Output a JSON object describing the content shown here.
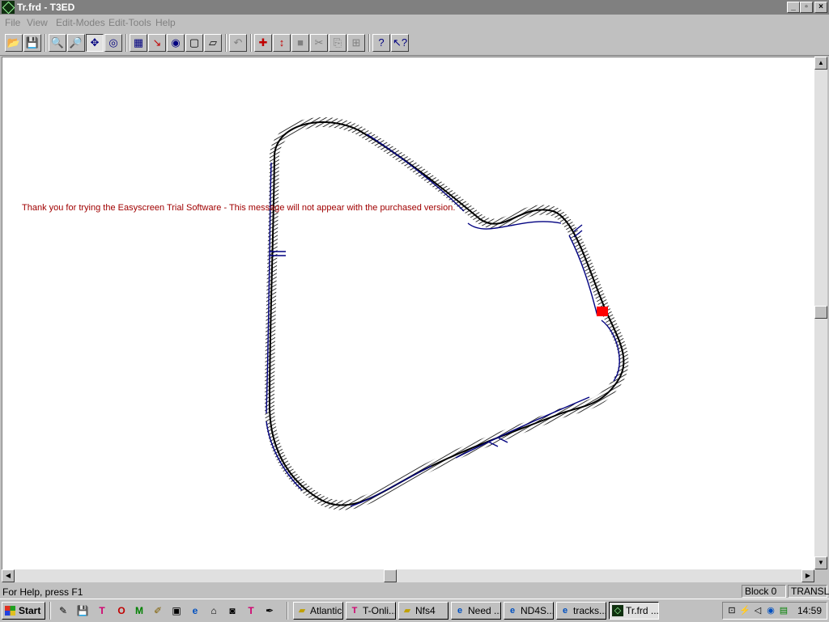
{
  "window": {
    "title": "Tr.frd - T3ED",
    "minimize": "_",
    "maximize": "▫",
    "close": "×"
  },
  "menu": [
    "File",
    "View",
    "Edit-Modes",
    "Edit-Tools",
    "Help"
  ],
  "toolbar_icons": [
    "open-icon",
    "save-icon",
    "zoom-in-icon",
    "zoom-out-icon",
    "move-icon",
    "rotate-view-icon",
    "track-mode-icon",
    "node-mode-icon",
    "object-mode-icon",
    "block-mode-icon",
    "polygon-mode-icon",
    "undo-icon",
    "translate-icon",
    "vertical-move-icon",
    "fill-icon",
    "cut-icon",
    "copy-icon",
    "paste-icon",
    "help-icon",
    "context-help-icon"
  ],
  "canvas": {
    "trial_message": "Thank you for trying the Easyscreen Trial Software - This message will not appear with the purchased version."
  },
  "statusbar": {
    "help_text": "For Help, press F1",
    "block": "Block 0",
    "mode": "TRANSL"
  },
  "taskbar": {
    "start_label": "Start",
    "tasks": [
      "Atlantic",
      "T-Onli...",
      "Nfs4",
      "Need ...",
      "ND4S...",
      "tracks...",
      "Tr.frd ..."
    ],
    "clock": "14:59"
  },
  "colors": {
    "track_outline": "#000000",
    "track_detail": "#000080",
    "selection": "#ff0000",
    "trial_text": "#a00000"
  }
}
